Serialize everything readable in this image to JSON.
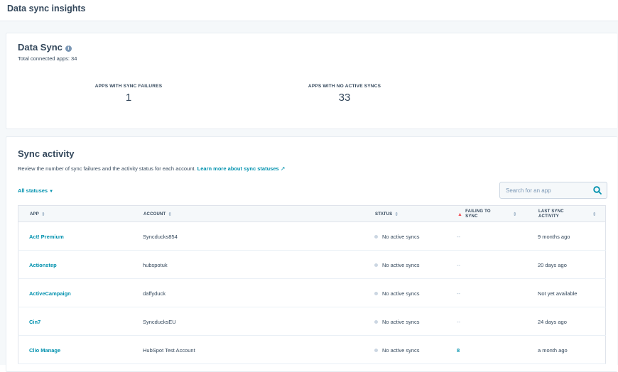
{
  "page": {
    "title": "Data sync insights"
  },
  "summary": {
    "title": "Data Sync",
    "info_icon": "info-icon",
    "total_label": "Total connected apps: 34",
    "stats": [
      {
        "label": "APPS WITH SYNC FAILURES",
        "value": "1"
      },
      {
        "label": "APPS WITH NO ACTIVE SYNCS",
        "value": "33"
      }
    ]
  },
  "activity": {
    "title": "Sync activity",
    "description": "Review the number of sync failures and the activity status for each account.",
    "learn_more": "Learn more about sync statuses",
    "filter_label": "All statuses",
    "search_placeholder": "Search for an app",
    "columns": {
      "app": "APP",
      "account": "ACCOUNT",
      "status": "STATUS",
      "failing_line1": "FAILING TO",
      "failing_line2": "SYNC",
      "last_line1": "LAST SYNC",
      "last_line2": "ACTIVITY"
    },
    "rows": [
      {
        "app": "Act! Premium",
        "account": "Syncducks854",
        "status": "No active syncs",
        "failing": "--",
        "last": "9 months ago"
      },
      {
        "app": "Actionstep",
        "account": "hubspotuk",
        "status": "No active syncs",
        "failing": "--",
        "last": "20 days ago"
      },
      {
        "app": "ActiveCampaign",
        "account": "daffyduck",
        "status": "No active syncs",
        "failing": "--",
        "last": "Not yet available"
      },
      {
        "app": "Cin7",
        "account": "SyncducksEU",
        "status": "No active syncs",
        "failing": "--",
        "last": "24 days ago"
      },
      {
        "app": "Clio Manage",
        "account": "HubSpot Test Account",
        "status": "No active syncs",
        "failing": "8",
        "last": "a month ago"
      }
    ]
  },
  "colors": {
    "link": "#0091ae",
    "text": "#33475b",
    "warning": "#f2545b",
    "background": "#f5f8fa"
  }
}
